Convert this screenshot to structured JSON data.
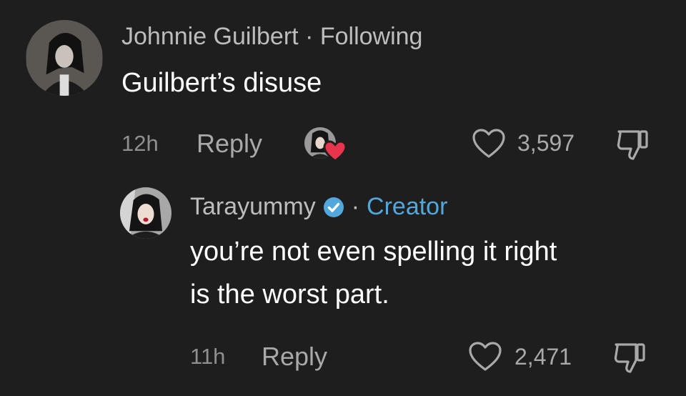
{
  "comment": {
    "author": "Johnnie Guilbert",
    "separator": "·",
    "follow_status": "Following",
    "text": "Guilbert’s disuse",
    "time": "12h",
    "reply_label": "Reply",
    "like_count": "3,597",
    "creator_liked": true
  },
  "reply": {
    "author": "Tarayummy",
    "verified": true,
    "separator": "·",
    "badge": "Creator",
    "text_line1": "you’re not even spelling it right",
    "text_line2": "is the worst part.",
    "time": "11h",
    "reply_label": "Reply",
    "like_count": "2,471"
  },
  "colors": {
    "background": "#1e1e1e",
    "creator_badge": "#52a8dc",
    "verified": "#52a8dc",
    "heart_badge": "#e8354d"
  },
  "icons": [
    "heart-outline-icon",
    "thumbs-down-icon",
    "verified-check-icon",
    "heart-filled-icon"
  ]
}
